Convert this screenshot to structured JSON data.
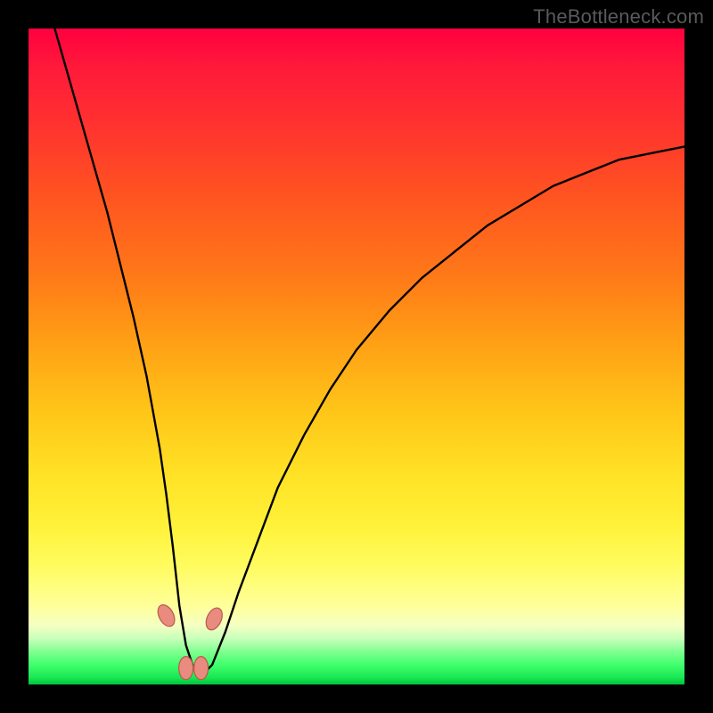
{
  "watermark": "TheBottleneck.com",
  "chart_data": {
    "type": "line",
    "title": "",
    "xlabel": "",
    "ylabel": "",
    "xlim": [
      0,
      100
    ],
    "ylim": [
      0,
      100
    ],
    "gradient_stops": [
      {
        "pos": 0,
        "color": "#ff0040"
      },
      {
        "pos": 6,
        "color": "#ff1a3a"
      },
      {
        "pos": 14,
        "color": "#ff3030"
      },
      {
        "pos": 26,
        "color": "#ff5520"
      },
      {
        "pos": 38,
        "color": "#ff7a18"
      },
      {
        "pos": 48,
        "color": "#ffa015"
      },
      {
        "pos": 58,
        "color": "#ffc418"
      },
      {
        "pos": 68,
        "color": "#ffe225"
      },
      {
        "pos": 76,
        "color": "#fff23a"
      },
      {
        "pos": 82,
        "color": "#fffc60"
      },
      {
        "pos": 88,
        "color": "#ffff9a"
      },
      {
        "pos": 91,
        "color": "#f5ffc2"
      },
      {
        "pos": 93,
        "color": "#c8ffba"
      },
      {
        "pos": 95,
        "color": "#80ff90"
      },
      {
        "pos": 97,
        "color": "#40ff6c"
      },
      {
        "pos": 99,
        "color": "#18e652"
      },
      {
        "pos": 100,
        "color": "#00c43c"
      }
    ],
    "series": [
      {
        "name": "bottleneck-curve",
        "x": [
          4,
          6,
          8,
          10,
          12,
          14,
          16,
          18,
          20,
          21,
          22,
          23,
          24,
          25,
          26,
          27,
          28,
          30,
          32,
          35,
          38,
          42,
          46,
          50,
          55,
          60,
          65,
          70,
          75,
          80,
          85,
          90,
          95,
          100
        ],
        "y": [
          100,
          93,
          86,
          79,
          72,
          64,
          56,
          47,
          36,
          29,
          21,
          12,
          6,
          3,
          2,
          2,
          3,
          8,
          14,
          22,
          30,
          38,
          45,
          51,
          57,
          62,
          66,
          70,
          73,
          76,
          78,
          80,
          81,
          82
        ]
      }
    ],
    "markers": [
      {
        "name": "marker-left-upper",
        "x": 21.0,
        "y": 10.5
      },
      {
        "name": "marker-right-upper",
        "x": 28.3,
        "y": 10.0
      },
      {
        "name": "marker-bottom-left",
        "x": 24.0,
        "y": 2.5
      },
      {
        "name": "marker-bottom-right",
        "x": 26.3,
        "y": 2.5
      }
    ],
    "marker_style": {
      "fill": "#e98b7e",
      "stroke": "#b85b4e",
      "rx": 8,
      "ry": 13
    }
  }
}
